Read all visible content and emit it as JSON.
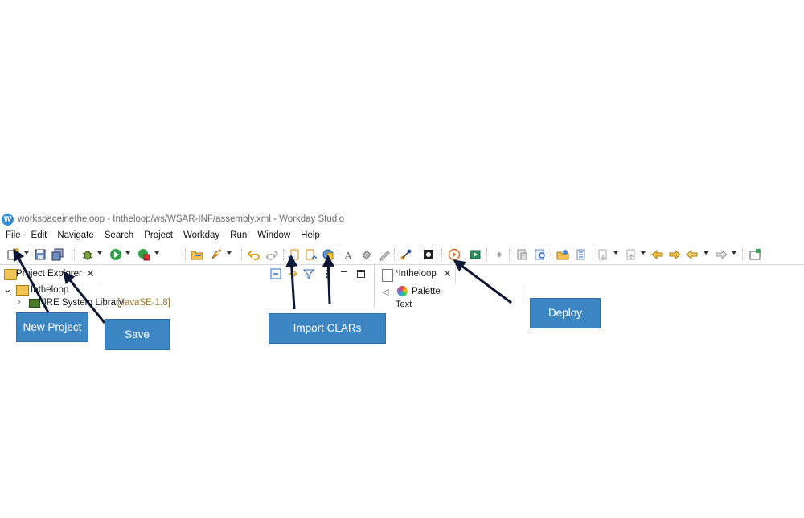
{
  "window": {
    "logo_letter": "W",
    "title": "workspaceinetheloop - Intheloop/ws/WSAR-INF/assembly.xml - Workday Studio"
  },
  "menu": [
    "File",
    "Edit",
    "Navigate",
    "Search",
    "Project",
    "Workday",
    "Run",
    "Window",
    "Help"
  ],
  "project_explorer": {
    "tab_label": "Project Explorer",
    "close_glyph": "✕",
    "tree": [
      {
        "label": "Intheloop",
        "expanded": true
      },
      {
        "label": "JRE System Library",
        "suffix": "[JavaSE-1.8]"
      }
    ]
  },
  "editor": {
    "tab_label": "*Intheloop",
    "close_glyph": "✕",
    "palette_label": "Palette",
    "palette_item": "Text"
  },
  "toolbar_icons": [
    "new-project-icon",
    "save-icon",
    "save-all-icon",
    "debug-icon",
    "run-icon",
    "external-tools-icon",
    "open-icon",
    "deploy-rocket-icon",
    "undo-icon",
    "redo-icon",
    "import-clar-icon",
    "export-clar-icon",
    "clar-globe-icon",
    "text-icon",
    "paint-icon",
    "pen-icon",
    "connect-icon",
    "puzzle-icon",
    "deploy-icon",
    "launch-icon",
    "pin-icon",
    "copy-icon",
    "search-icon",
    "open-type-icon",
    "open-resource-icon",
    "next-annotation-icon",
    "prev-annotation-icon",
    "back-icon",
    "forward-icon",
    "open-perspective-icon"
  ],
  "callouts": {
    "new_project": "New Project",
    "save": "Save",
    "import_clars": "Import CLARs",
    "deploy": "Deploy"
  },
  "colors": {
    "callout_fill": "#3c86c4",
    "arrow": "#0d1733"
  }
}
